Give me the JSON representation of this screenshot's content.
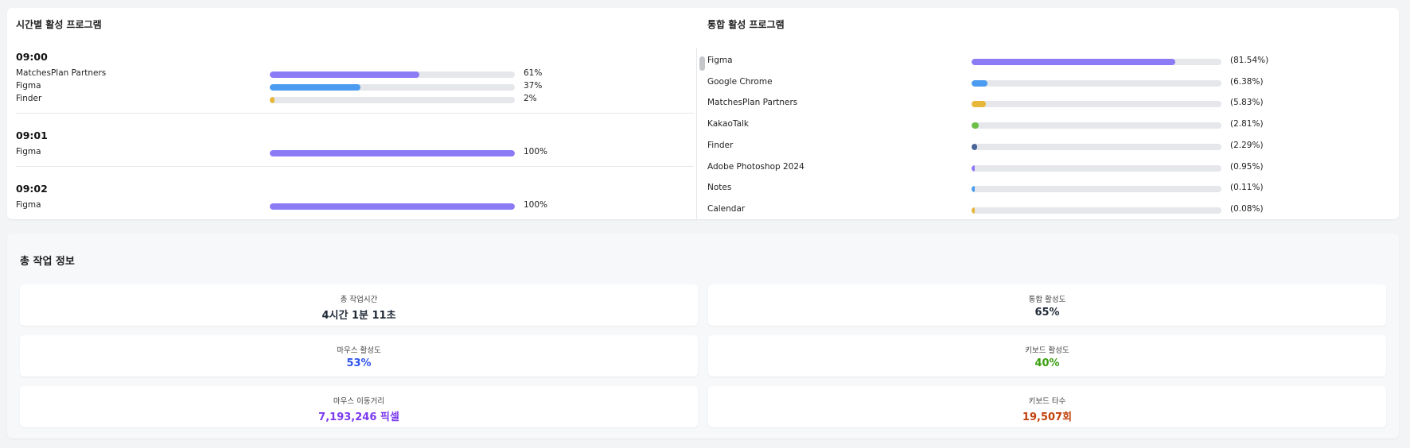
{
  "hourly": {
    "title": "시간별 활성 프로그램",
    "groups": [
      {
        "time": "09:00",
        "programs": [
          {
            "name": "MatchesPlan Partners",
            "pct": 61,
            "pct_label": "61%",
            "color": "#8b7cf6"
          },
          {
            "name": "Figma",
            "pct": 37,
            "pct_label": "37%",
            "color": "#4b9cf0"
          },
          {
            "name": "Finder",
            "pct": 2,
            "pct_label": "2%",
            "color": "#e7b73a"
          }
        ]
      },
      {
        "time": "09:01",
        "programs": [
          {
            "name": "Figma",
            "pct": 100,
            "pct_label": "100%",
            "color": "#8b7cf6"
          }
        ]
      },
      {
        "time": "09:02",
        "programs": [
          {
            "name": "Figma",
            "pct": 100,
            "pct_label": "100%",
            "color": "#8b7cf6"
          }
        ]
      }
    ]
  },
  "total": {
    "title": "통합 활성 프로그램",
    "programs": [
      {
        "name": "Figma",
        "pct": 81.54,
        "pct_label": "(81.54%)",
        "color": "#8b7cf6"
      },
      {
        "name": "Google Chrome",
        "pct": 6.38,
        "pct_label": "(6.38%)",
        "color": "#4b9cf0"
      },
      {
        "name": "MatchesPlan Partners",
        "pct": 5.83,
        "pct_label": "(5.83%)",
        "color": "#e7b73a"
      },
      {
        "name": "KakaoTalk",
        "pct": 2.81,
        "pct_label": "(2.81%)",
        "color": "#6cc04a"
      },
      {
        "name": "Finder",
        "pct": 2.29,
        "pct_label": "(2.29%)",
        "color": "#4a6597"
      },
      {
        "name": "Adobe Photoshop 2024",
        "pct": 0.95,
        "pct_label": "(0.95%)",
        "color": "#8b7cf6"
      },
      {
        "name": "Notes",
        "pct": 0.11,
        "pct_label": "(0.11%)",
        "color": "#4b9cf0"
      },
      {
        "name": "Calendar",
        "pct": 0.08,
        "pct_label": "(0.08%)",
        "color": "#e7b73a"
      }
    ]
  },
  "summary": {
    "title": "총 작업 정보",
    "total_time_label": "총 작업시간",
    "total_time_value": "4시간 1분 11초",
    "overall_activity_label": "통합 활성도",
    "overall_activity_value": "65%",
    "mouse_activity_label": "마우스 활성도",
    "mouse_activity_value": "53%",
    "keyboard_activity_label": "키보드 활성도",
    "keyboard_activity_value": "40%",
    "mouse_distance_label": "마우스 이동거리",
    "mouse_distance_value": "7,193,246 픽셀",
    "key_count_label": "키보드 타수",
    "key_count_value": "19,507회",
    "colors": {
      "default": "#1f2937",
      "mouse_activity": "#2f54eb",
      "keyboard_activity": "#389e0d",
      "mouse_distance": "#7c3aed",
      "key_count": "#c2410c"
    }
  }
}
